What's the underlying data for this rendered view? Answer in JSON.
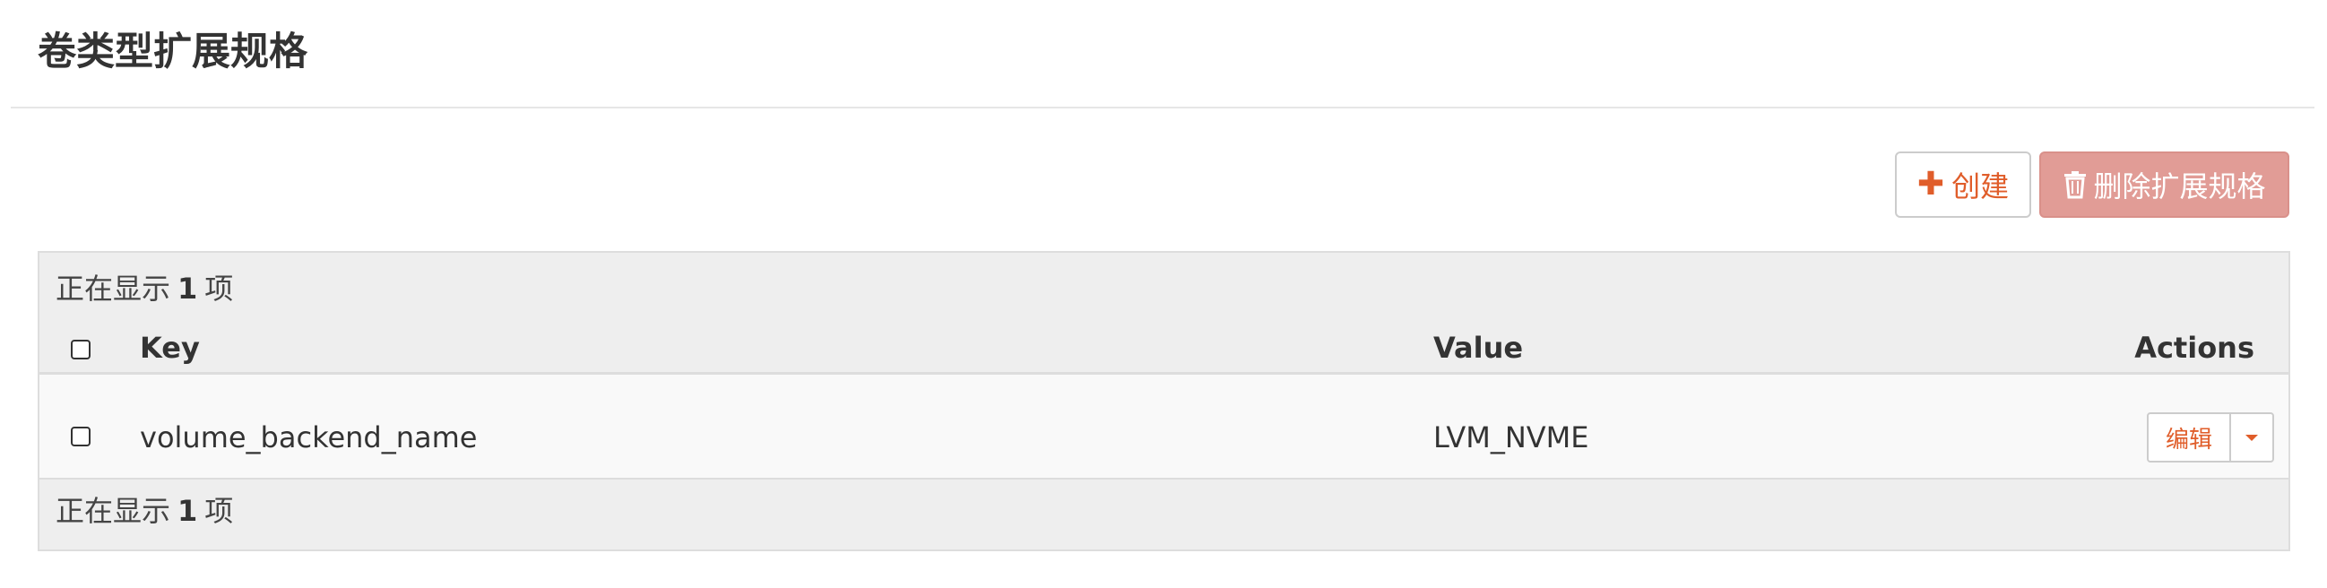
{
  "page": {
    "title": "卷类型扩展规格"
  },
  "toolbar": {
    "create_label": "创建",
    "delete_label": "删除扩展规格"
  },
  "table": {
    "count_prefix": "正在显示",
    "count_value": "1",
    "count_suffix": "项",
    "columns": {
      "key": "Key",
      "value": "Value",
      "actions": "Actions"
    },
    "rows": [
      {
        "key": "volume_backend_name",
        "value": "LVM_NVME",
        "action_label": "编辑"
      }
    ]
  },
  "icons": {
    "create": "plus-icon",
    "delete": "trash-icon",
    "dropdown": "caret-down-icon"
  },
  "colors": {
    "accent": "#e05d2a",
    "danger_button": "#e19c96",
    "table_header_bg": "#eeeeee"
  }
}
